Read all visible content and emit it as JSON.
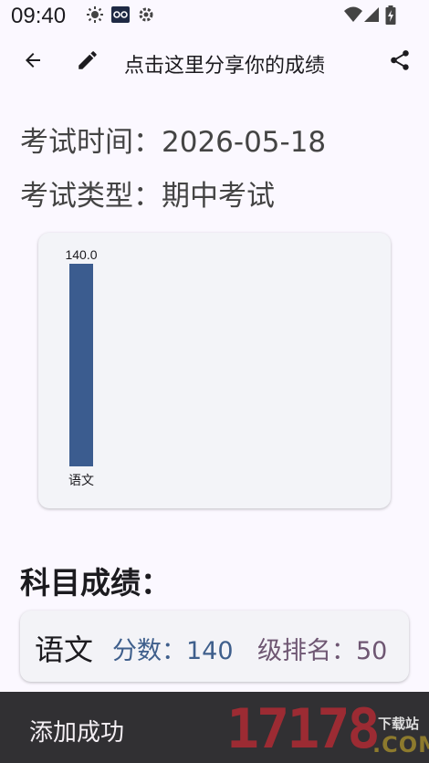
{
  "status_bar": {
    "time": "09:40",
    "icons": [
      "brightness-icon",
      "app-notification-icon",
      "settings-icon",
      "wifi-icon",
      "cell-signal-icon",
      "battery-charging-icon"
    ]
  },
  "app_bar": {
    "title": "点击这里分享你的成绩",
    "icons": [
      "back-arrow-icon",
      "edit-pencil-icon",
      "share-icon"
    ]
  },
  "exam": {
    "date_label": "考试时间：",
    "date_value": "2026-05-18",
    "type_label": "考试类型：",
    "type_value": "期中考试"
  },
  "chart_data": {
    "type": "bar",
    "categories": [
      "语文"
    ],
    "values": [
      140.0
    ],
    "value_labels": [
      "140.0"
    ],
    "ylim": [
      0,
      140
    ],
    "bar_color": "#3b5c8f",
    "grid": false,
    "legend": "none"
  },
  "section_title": "科目成绩：",
  "subjects": [
    {
      "name": "语文",
      "score_label": "分数：",
      "score": "140",
      "rank_label": "级排名：",
      "rank": "50"
    }
  ],
  "colors": {
    "score_color": "#3f5f8c",
    "rank_color": "#6e5672",
    "bar_color": "#3b5c8f"
  },
  "snackbar": {
    "message": "添加成功"
  },
  "watermark": {
    "number": "17178",
    "tag": "下载站",
    "domain": ".COM"
  }
}
